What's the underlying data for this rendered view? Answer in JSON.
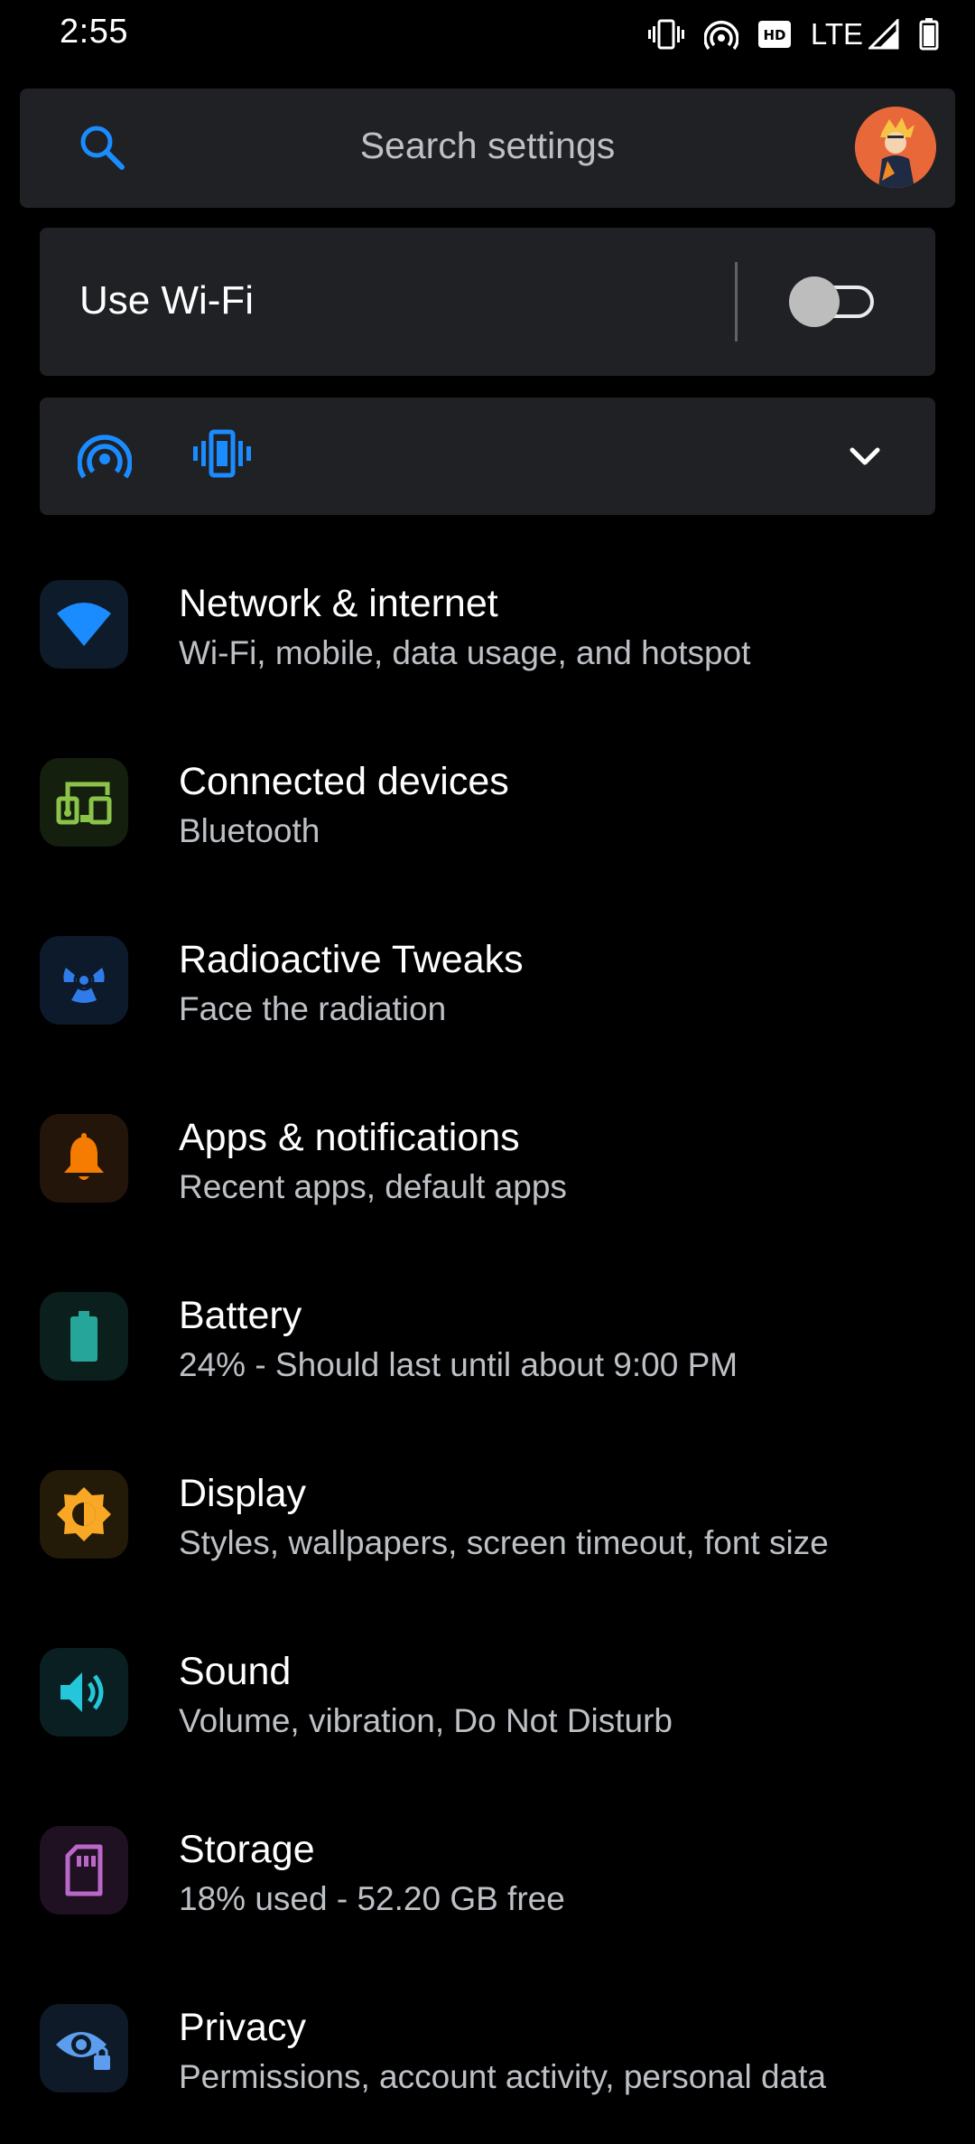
{
  "status_bar": {
    "time": "2:55",
    "network_type": "LTE",
    "hd_badge": "HD",
    "icons": [
      "vibrate-icon",
      "hotspot-icon",
      "hd-icon",
      "signal-icon",
      "battery-icon"
    ]
  },
  "search": {
    "placeholder": "Search settings"
  },
  "wifi": {
    "label": "Use Wi-Fi",
    "enabled": false
  },
  "conditions": {
    "icons": [
      "hotspot-icon",
      "vibrate-icon"
    ]
  },
  "colors": {
    "background": "#000000",
    "card": "#202124",
    "accent_blue": "#1a8cff",
    "text_primary": "#ffffff",
    "text_secondary": "#bdc1c6"
  },
  "settings": [
    {
      "title": "Network & internet",
      "subtitle": "Wi-Fi, mobile, data usage, and hotspot",
      "icon": "wifi-icon",
      "color": "#1a8cff",
      "bg": "#0d1b2a"
    },
    {
      "title": "Connected devices",
      "subtitle": "Bluetooth",
      "icon": "devices-icon",
      "color": "#8bc34a",
      "bg": "#141f0e"
    },
    {
      "title": "Radioactive Tweaks",
      "subtitle": "Face the radiation",
      "icon": "radiation-icon",
      "color": "#2f7be8",
      "bg": "#0d1a2b"
    },
    {
      "title": "Apps & notifications",
      "subtitle": "Recent apps, default apps",
      "icon": "bell-icon",
      "color": "#f57c00",
      "bg": "#24150a"
    },
    {
      "title": "Battery",
      "subtitle": "24% - Should last until about 9:00 PM",
      "icon": "battery-icon",
      "color": "#26a69a",
      "bg": "#0b1f1d"
    },
    {
      "title": "Display",
      "subtitle": "Styles, wallpapers, screen timeout, font size",
      "icon": "brightness-icon",
      "color": "#f9a825",
      "bg": "#241a08"
    },
    {
      "title": "Sound",
      "subtitle": "Volume, vibration, Do Not Disturb",
      "icon": "volume-icon",
      "color": "#26c6da",
      "bg": "#0a1f21"
    },
    {
      "title": "Storage",
      "subtitle": "18% used - 52.20 GB free",
      "icon": "sd-card-icon",
      "color": "#ba68c8",
      "bg": "#1f1022"
    },
    {
      "title": "Privacy",
      "subtitle": "Permissions, account activity, personal data",
      "icon": "privacy-icon",
      "color": "#5c9ded",
      "bg": "#0f1a28"
    }
  ]
}
